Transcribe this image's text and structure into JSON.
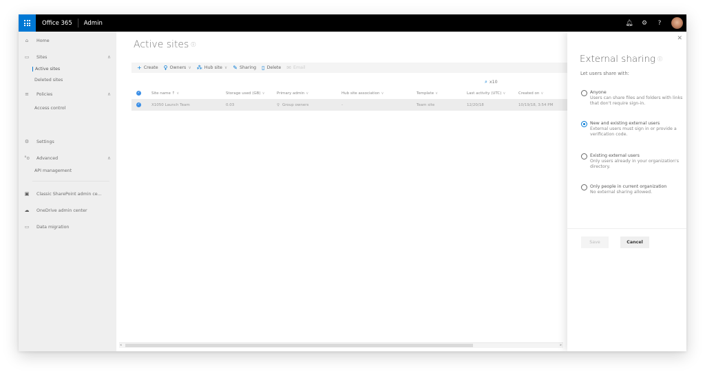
{
  "topbar": {
    "brand": "Office 365",
    "app": "Admin",
    "icons": [
      "bell-icon",
      "gear-icon",
      "help-icon"
    ]
  },
  "sidebar": {
    "items": [
      {
        "label": "Home",
        "icon": "home-icon"
      },
      {
        "label": "Sites",
        "icon": "sites-icon",
        "expanded": true,
        "children": [
          "Active sites",
          "Deleted sites"
        ]
      },
      {
        "label": "Policies",
        "icon": "policies-icon",
        "expanded": true,
        "children": [
          "Access control"
        ]
      },
      {
        "label": "Settings",
        "icon": "settings-icon"
      },
      {
        "label": "Advanced",
        "icon": "advanced-icon",
        "expanded": true,
        "children": [
          "API management"
        ]
      },
      {
        "label": "Classic SharePoint admin ce...",
        "icon": "sharepoint-icon"
      },
      {
        "label": "OneDrive admin center",
        "icon": "onedrive-icon"
      },
      {
        "label": "Data migration",
        "icon": "migration-icon"
      }
    ],
    "active": "Active sites"
  },
  "main": {
    "title": "Active sites",
    "commands": [
      {
        "label": "Create",
        "icon": "plus-icon"
      },
      {
        "label": "Owners",
        "icon": "owners-icon",
        "dropdown": true
      },
      {
        "label": "Hub site",
        "icon": "hub-icon",
        "dropdown": true
      },
      {
        "label": "Sharing",
        "icon": "pencil-icon"
      },
      {
        "label": "Delete",
        "icon": "trash-icon"
      },
      {
        "label": "Email",
        "icon": "mail-icon",
        "disabled": true
      }
    ],
    "search": {
      "value": "x10"
    },
    "table": {
      "columns": [
        "Site name ↑",
        "Storage used (GB)",
        "Primary admin",
        "Hub site association",
        "Template",
        "Last activity (UTC)",
        "Created on"
      ],
      "rows": [
        {
          "selected": true,
          "cells": [
            "X1050 Launch Team",
            "0.03",
            "Group owners",
            "-",
            "Team site",
            "12/20/18",
            "10/19/18, 3:54 PM"
          ]
        }
      ]
    }
  },
  "panel": {
    "title": "External sharing",
    "subtitle": "Let users share with:",
    "options": [
      {
        "label": "Anyone",
        "desc": "Users can share files and folders with links that don't require sign-in.",
        "checked": false
      },
      {
        "label": "New and existing external users",
        "desc": "External users must sign in or provide a verification code.",
        "checked": true
      },
      {
        "label": "Existing external users",
        "desc": "Only users already in your organization's directory.",
        "checked": false
      },
      {
        "label": "Only people in current organization",
        "desc": "No external sharing allowed.",
        "checked": false
      }
    ],
    "save_label": "Save",
    "cancel_label": "Cancel"
  },
  "colors": {
    "accent": "#0078d4",
    "topbar": "#000000"
  }
}
